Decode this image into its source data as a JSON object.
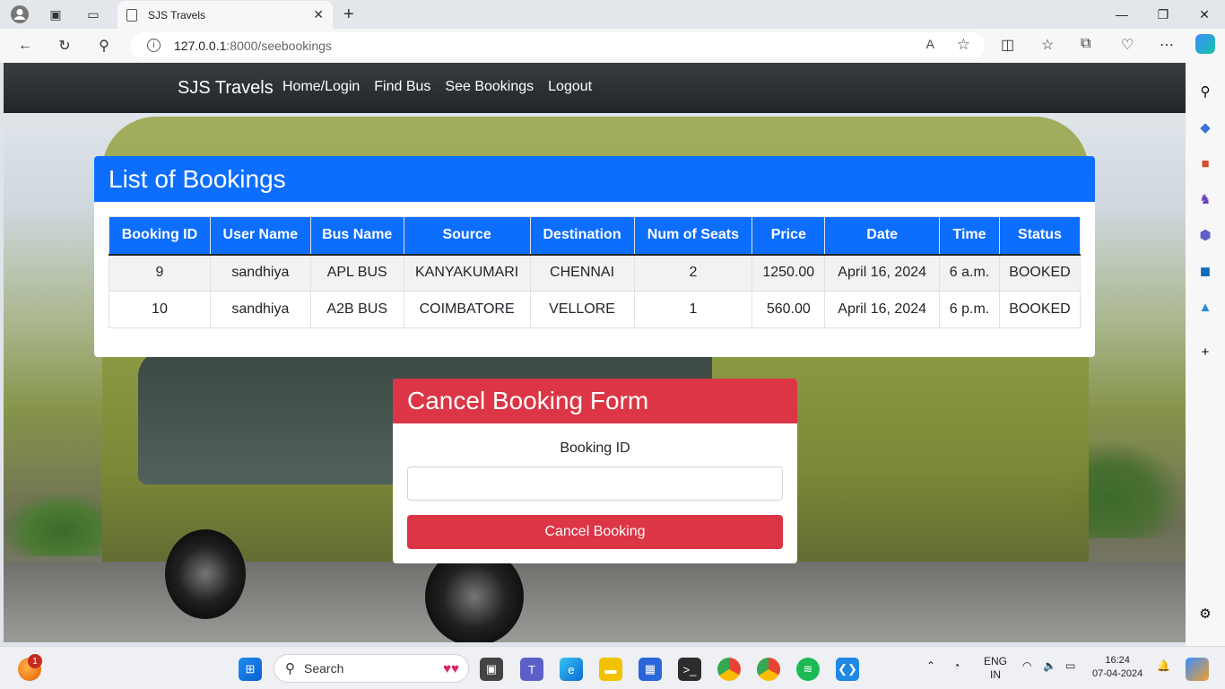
{
  "browser": {
    "tab_title": "SJS Travels",
    "url_host": "127.0.0.1",
    "url_path": ":8000/seebookings",
    "new_tab_symbol": "+",
    "close_tab_symbol": "✕"
  },
  "navbar": {
    "brand": "SJS Travels",
    "links": [
      "Home/Login",
      "Find Bus",
      "See Bookings",
      "Logout"
    ]
  },
  "bookings": {
    "title": "List of Bookings",
    "columns": [
      "Booking ID",
      "User Name",
      "Bus Name",
      "Source",
      "Destination",
      "Num of Seats",
      "Price",
      "Date",
      "Time",
      "Status"
    ],
    "rows": [
      [
        "9",
        "sandhiya",
        "APL BUS",
        "KANYAKUMARI",
        "CHENNAI",
        "2",
        "1250.00",
        "April 16, 2024",
        "6 a.m.",
        "BOOKED"
      ],
      [
        "10",
        "sandhiya",
        "A2B BUS",
        "COIMBATORE",
        "VELLORE",
        "1",
        "560.00",
        "April 16, 2024",
        "6 p.m.",
        "BOOKED"
      ]
    ]
  },
  "cancel_form": {
    "title": "Cancel Booking Form",
    "label": "Booking ID",
    "input_value": "",
    "button": "Cancel Booking"
  },
  "taskbar": {
    "search_label": "Search",
    "notification_count": "1",
    "lang_line1": "ENG",
    "lang_line2": "IN",
    "time": "16:24",
    "date": "07-04-2024"
  },
  "colors": {
    "primary": "#0d6efd",
    "danger": "#dc3545",
    "navbar": "#212428"
  }
}
